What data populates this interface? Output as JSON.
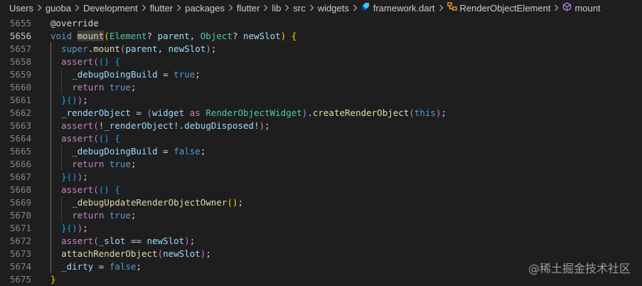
{
  "breadcrumb": [
    {
      "label": "Users",
      "icon": null
    },
    {
      "label": "guoba",
      "icon": null
    },
    {
      "label": "Development",
      "icon": null
    },
    {
      "label": "flutter",
      "icon": null
    },
    {
      "label": "packages",
      "icon": null
    },
    {
      "label": "flutter",
      "icon": null
    },
    {
      "label": "lib",
      "icon": null
    },
    {
      "label": "src",
      "icon": null
    },
    {
      "label": "widgets",
      "icon": null
    },
    {
      "label": "framework.dart",
      "icon": "dart-file-icon"
    },
    {
      "label": "RenderObjectElement",
      "icon": "class-symbol-icon"
    },
    {
      "label": "mount",
      "icon": "method-symbol-icon"
    }
  ],
  "active_line": 5656,
  "lines": [
    {
      "num": "5655",
      "indent": 0,
      "tokens": [
        [
          "@override",
          "default"
        ]
      ]
    },
    {
      "num": "5656",
      "indent": 0,
      "tokens": [
        [
          "void",
          "keyword"
        ],
        [
          " ",
          "default"
        ],
        [
          "mount",
          "function",
          "highlight"
        ],
        [
          "(",
          "bracket1"
        ],
        [
          "Element",
          "type"
        ],
        [
          "? ",
          "default"
        ],
        [
          "parent",
          "variable"
        ],
        [
          ", ",
          "default"
        ],
        [
          "Object",
          "type"
        ],
        [
          "? ",
          "default"
        ],
        [
          "newSlot",
          "variable"
        ],
        [
          ")",
          "bracket1"
        ],
        [
          " ",
          "default"
        ],
        [
          "{",
          "bracket1"
        ]
      ]
    },
    {
      "num": "5657",
      "indent": 1,
      "tokens": [
        [
          "super",
          "keyword"
        ],
        [
          ".",
          "default"
        ],
        [
          "mount",
          "function"
        ],
        [
          "(",
          "bracket2"
        ],
        [
          "parent",
          "variable"
        ],
        [
          ", ",
          "default"
        ],
        [
          "newSlot",
          "variable"
        ],
        [
          ")",
          "bracket2"
        ],
        [
          ";",
          "default"
        ]
      ]
    },
    {
      "num": "5658",
      "indent": 1,
      "tokens": [
        [
          "assert",
          "control"
        ],
        [
          "(",
          "bracket2"
        ],
        [
          "()",
          "bracket3"
        ],
        [
          " ",
          "default"
        ],
        [
          "{",
          "bracket3"
        ]
      ]
    },
    {
      "num": "5659",
      "indent": 2,
      "tokens": [
        [
          "_debugDoingBuild",
          "variable"
        ],
        [
          " = ",
          "default"
        ],
        [
          "true",
          "keyword"
        ],
        [
          ";",
          "default"
        ]
      ]
    },
    {
      "num": "5660",
      "indent": 2,
      "tokens": [
        [
          "return",
          "control"
        ],
        [
          " ",
          "default"
        ],
        [
          "true",
          "keyword"
        ],
        [
          ";",
          "default"
        ]
      ]
    },
    {
      "num": "5661",
      "indent": 1,
      "tokens": [
        [
          "}",
          "bracket3"
        ],
        [
          "()",
          "bracket3"
        ],
        [
          ")",
          "bracket2"
        ],
        [
          ";",
          "default"
        ]
      ]
    },
    {
      "num": "5662",
      "indent": 1,
      "tokens": [
        [
          "_renderObject",
          "variable"
        ],
        [
          " = ",
          "default"
        ],
        [
          "(",
          "bracket2"
        ],
        [
          "widget",
          "variable"
        ],
        [
          " ",
          "default"
        ],
        [
          "as",
          "control"
        ],
        [
          " ",
          "default"
        ],
        [
          "RenderObjectWidget",
          "type"
        ],
        [
          ")",
          "bracket2"
        ],
        [
          ".",
          "default"
        ],
        [
          "createRenderObject",
          "function"
        ],
        [
          "(",
          "bracket2"
        ],
        [
          "this",
          "keyword"
        ],
        [
          ")",
          "bracket2"
        ],
        [
          ";",
          "default"
        ]
      ]
    },
    {
      "num": "5663",
      "indent": 1,
      "tokens": [
        [
          "assert",
          "control"
        ],
        [
          "(",
          "bracket2"
        ],
        [
          "!",
          "default"
        ],
        [
          "_renderObject",
          "variable"
        ],
        [
          "!.",
          "default"
        ],
        [
          "debugDisposed",
          "variable"
        ],
        [
          "!",
          "default"
        ],
        [
          ")",
          "bracket2"
        ],
        [
          ";",
          "default"
        ]
      ]
    },
    {
      "num": "5664",
      "indent": 1,
      "tokens": [
        [
          "assert",
          "control"
        ],
        [
          "(",
          "bracket2"
        ],
        [
          "()",
          "bracket3"
        ],
        [
          " ",
          "default"
        ],
        [
          "{",
          "bracket3"
        ]
      ]
    },
    {
      "num": "5665",
      "indent": 2,
      "tokens": [
        [
          "_debugDoingBuild",
          "variable"
        ],
        [
          " = ",
          "default"
        ],
        [
          "false",
          "keyword"
        ],
        [
          ";",
          "default"
        ]
      ]
    },
    {
      "num": "5666",
      "indent": 2,
      "tokens": [
        [
          "return",
          "control"
        ],
        [
          " ",
          "default"
        ],
        [
          "true",
          "keyword"
        ],
        [
          ";",
          "default"
        ]
      ]
    },
    {
      "num": "5667",
      "indent": 1,
      "tokens": [
        [
          "}",
          "bracket3"
        ],
        [
          "()",
          "bracket3"
        ],
        [
          ")",
          "bracket2"
        ],
        [
          ";",
          "default"
        ]
      ]
    },
    {
      "num": "5668",
      "indent": 1,
      "tokens": [
        [
          "assert",
          "control"
        ],
        [
          "(",
          "bracket2"
        ],
        [
          "()",
          "bracket3"
        ],
        [
          " ",
          "default"
        ],
        [
          "{",
          "bracket3"
        ]
      ]
    },
    {
      "num": "5669",
      "indent": 2,
      "tokens": [
        [
          "_debugUpdateRenderObjectOwner",
          "function"
        ],
        [
          "()",
          "bracket1"
        ],
        [
          ";",
          "default"
        ]
      ]
    },
    {
      "num": "5670",
      "indent": 2,
      "tokens": [
        [
          "return",
          "control"
        ],
        [
          " ",
          "default"
        ],
        [
          "true",
          "keyword"
        ],
        [
          ";",
          "default"
        ]
      ]
    },
    {
      "num": "5671",
      "indent": 1,
      "tokens": [
        [
          "}",
          "bracket3"
        ],
        [
          "()",
          "bracket3"
        ],
        [
          ")",
          "bracket2"
        ],
        [
          ";",
          "default"
        ]
      ]
    },
    {
      "num": "5672",
      "indent": 1,
      "tokens": [
        [
          "assert",
          "control"
        ],
        [
          "(",
          "bracket2"
        ],
        [
          "_slot",
          "variable"
        ],
        [
          " == ",
          "default"
        ],
        [
          "newSlot",
          "variable"
        ],
        [
          ")",
          "bracket2"
        ],
        [
          ";",
          "default"
        ]
      ]
    },
    {
      "num": "5673",
      "indent": 1,
      "tokens": [
        [
          "attachRenderObject",
          "function"
        ],
        [
          "(",
          "bracket2"
        ],
        [
          "newSlot",
          "variable"
        ],
        [
          ")",
          "bracket2"
        ],
        [
          ";",
          "default"
        ]
      ]
    },
    {
      "num": "5674",
      "indent": 1,
      "tokens": [
        [
          "_dirty",
          "variable"
        ],
        [
          " = ",
          "default"
        ],
        [
          "false",
          "keyword"
        ],
        [
          ";",
          "default"
        ]
      ]
    },
    {
      "num": "5675",
      "indent": 0,
      "tokens": [
        [
          "}",
          "bracket1"
        ]
      ]
    }
  ],
  "watermark": "@稀土掘金技术社区",
  "colors": {
    "background": "#1e1e1e",
    "line_number": "#858585",
    "keyword": "#569cd6",
    "control": "#c586c0",
    "type": "#4ec9b0",
    "function": "#dcdcaa",
    "variable": "#9cdcfe",
    "bracket1": "#ffd700",
    "bracket2": "#da70d6",
    "bracket3": "#179fff"
  }
}
